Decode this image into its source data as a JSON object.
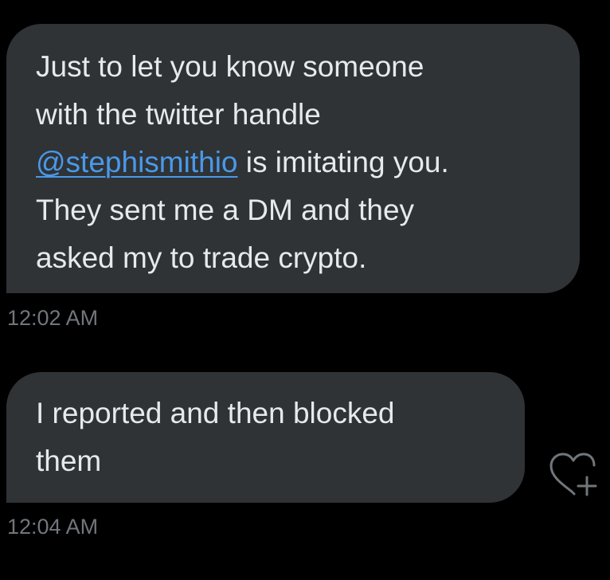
{
  "messages": [
    {
      "lines": [
        "Just to let you know someone",
        "with the twitter handle"
      ],
      "mention": "@stephismithio",
      "mention_suffix": " is imitating you.",
      "lines_after": [
        "They sent me a DM and they",
        "asked my to trade crypto."
      ],
      "time": "12:02 AM"
    },
    {
      "lines": [
        "I reported and then blocked",
        "them"
      ],
      "time": "12:04 AM"
    }
  ],
  "icons": {
    "react": "heart-plus-icon"
  },
  "colors": {
    "background": "#000000",
    "bubble": "#2f3336",
    "text": "#e7e9ea",
    "link": "#4a99e9",
    "timestamp": "#71767b"
  }
}
